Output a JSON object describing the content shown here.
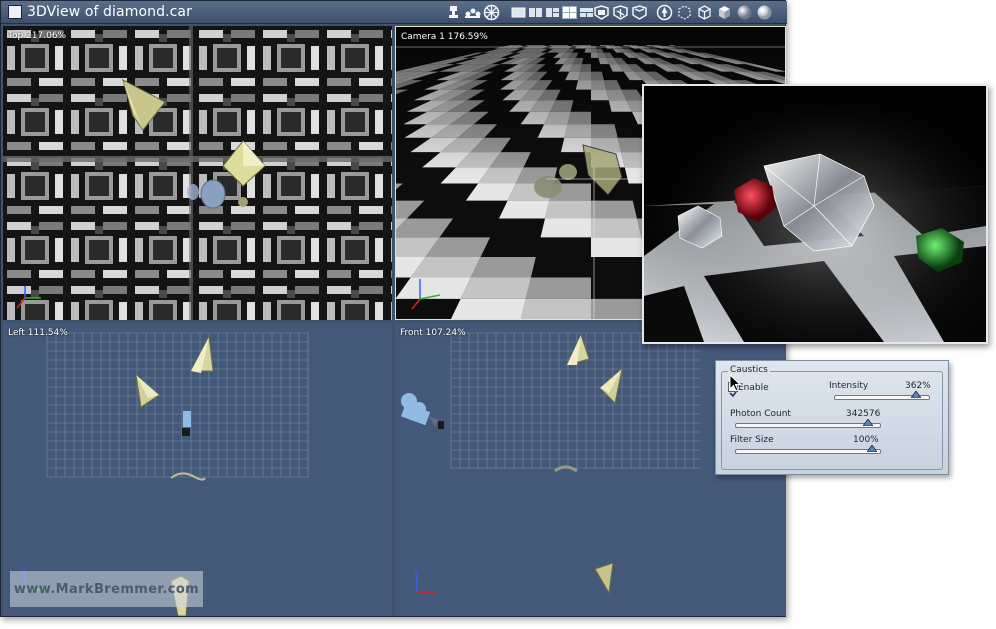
{
  "window": {
    "title": "3DView of diamond.car"
  },
  "toolbar": {
    "icons": [
      "camera-light-icon",
      "cameras-group-icon",
      "globe-icon",
      "layout-single-icon",
      "layout-two-icon",
      "layout-three-icon",
      "layout-four-icon",
      "layout-split-icon",
      "view-front-icon",
      "view-side-icon",
      "view-top-icon",
      "navigate-icon",
      "bounding-box-icon",
      "wireframe-icon",
      "flat-shade-icon",
      "smooth-shade-icon",
      "textured-shade-icon"
    ]
  },
  "viewports": {
    "top": {
      "label": "Top 217.06%"
    },
    "camera": {
      "label": "Camera 1 176.59%"
    },
    "left": {
      "label": "Left 111.54%"
    },
    "front": {
      "label": "Front 107.24%"
    }
  },
  "caustics": {
    "title": "Caustics",
    "enable_label": "Enable",
    "enabled": true,
    "intensity_label": "Intensity",
    "intensity_value": "362%",
    "intensity_level": 0.9,
    "photon_label": "Photon Count",
    "photon_value": "342576",
    "photon_level": 0.95,
    "filter_label": "Filter Size",
    "filter_value": "100%",
    "filter_level": 0.98
  },
  "watermark": "www.MarkBremmer.com",
  "colors": {
    "viewport_bg": "#44587a",
    "titlebar": "#4a5d79",
    "gem_yellow": "#d6d6a0",
    "camera_blue": "#9cc6ea",
    "ruby": "#c0141c",
    "emerald": "#22a030"
  }
}
